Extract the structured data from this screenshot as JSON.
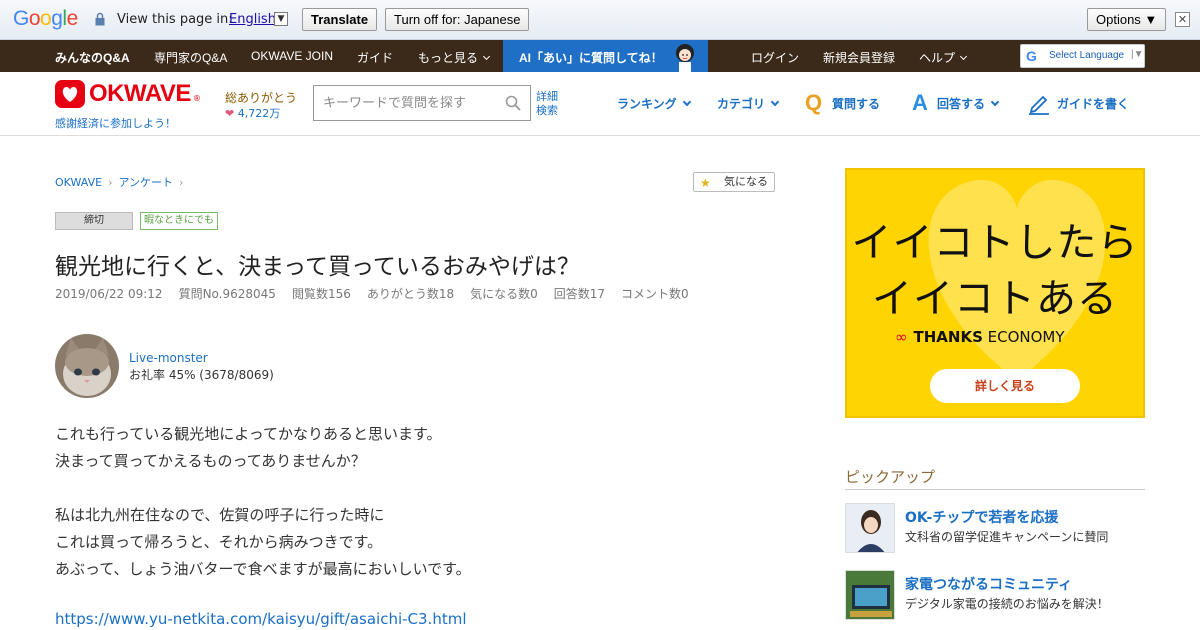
{
  "translate_bar": {
    "logo": "Google",
    "view_text": "View this page in:",
    "language": "English",
    "translate_label": "Translate",
    "turn_off_label": "Turn off for: Japanese",
    "options_label": "Options ▼"
  },
  "topnav": {
    "items": [
      "みんなのQ&A",
      "専門家のQ&A",
      "OKWAVE JOIN",
      "ガイド",
      "もっと見る"
    ],
    "ai_banner": "AI「あい」に質問してね！",
    "right_items": [
      "ログイン",
      "新規会員登録",
      "ヘルプ"
    ],
    "select_language": "Select Language"
  },
  "header": {
    "logo": "OKWAVE",
    "tagline": "感謝経済に参加しよう！",
    "thanks_label": "総ありがとう",
    "thanks_count": "4,722万",
    "search_placeholder": "キーワードで質問を探す",
    "advanced_search": "詳細検索",
    "nav": [
      "ランキング",
      "カテゴリ",
      "質問する",
      "回答する",
      "ガイドを書く"
    ]
  },
  "breadcrumb": [
    "OKWAVE",
    "アンケート"
  ],
  "favorite_label": "気になる",
  "tags": {
    "status": "締切",
    "category": "暇なときにでも"
  },
  "question": {
    "title": "観光地に行くと、決まって買っているおみやげは？",
    "meta": [
      "2019/06/22 09:12",
      "質問No.9628045",
      "閲覧数156",
      "ありがとう数18",
      "気になる数0",
      "回答数17",
      "コメント数0"
    ],
    "user": "Live-monster",
    "rate": "お礼率 45%   (3678/8069)",
    "body": [
      "これも行っている観光地によってかなりあると思います。",
      "決まって買ってかえるものってありませんか？",
      "",
      "私は北九州在住なので、佐賀の呼子に行った時に",
      "これは買って帰ろうと、それから病みつきです。",
      "あぶって、しょう油バターで食べますが最高においしいです。"
    ],
    "link": "https://www.yu-netkita.com/kaisyu/gift/asaichi-C3.html"
  },
  "ad": {
    "line1": "イイコトしたら",
    "line2": "イイコトある",
    "brand_bold": "THANKS",
    "brand_rest": " ECONOMY",
    "button": "詳しく見る",
    "color": "#ffd400"
  },
  "pickup": {
    "heading": "ピックアップ",
    "items": [
      {
        "title": "OK-チップで若者を応援",
        "desc": "文科省の留学促進キャンペーンに賛同"
      },
      {
        "title": "家電つながるコミュニティ",
        "desc": "デジタル家電の接続のお悩みを解決！"
      }
    ]
  },
  "colors": {
    "nav_bg": "#3b2a1a",
    "ai_banner_bg": "#1f6fc7",
    "brand_red": "#e60012",
    "link_blue": "#1a6fc4"
  }
}
